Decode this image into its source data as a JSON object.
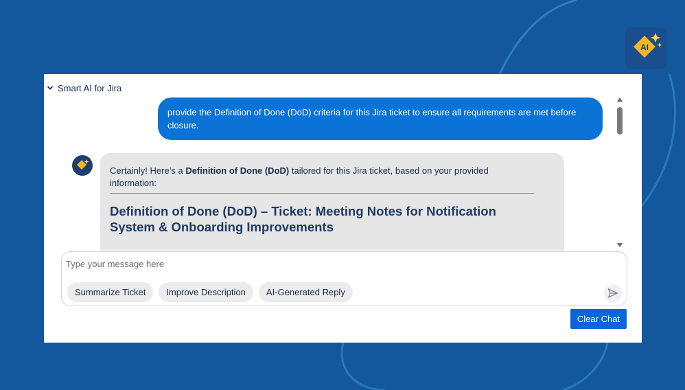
{
  "colors": {
    "background": "#13579c",
    "user_bubble": "#0b73d5",
    "bot_bubble": "#e6e6e6",
    "accent_gold": "#f5b623",
    "clear_button": "#0b66d8"
  },
  "app_badge": {
    "icon": "ai-sparkle-logo",
    "label": "AI"
  },
  "panel": {
    "title": "Smart AI for Jira",
    "collapse_icon": "chevron-down-icon"
  },
  "messages": {
    "user": "provide the Definition of Done (DoD) criteria for this Jira ticket to ensure all requirements are met before closure.",
    "bot": {
      "avatar_label": "AI",
      "intro_prefix": "Certainly! Here’s a ",
      "intro_bold": "Definition of Done (DoD)",
      "intro_suffix": " tailored for this Jira ticket, based on your provided information:",
      "heading": "Definition of Done (DoD) – Ticket: Meeting Notes for Notification System & Onboarding Improvements"
    }
  },
  "composer": {
    "placeholder": "Type your message here",
    "value": "",
    "chips": [
      "Summarize Ticket",
      "Improve Description",
      "AI-Generated Reply"
    ],
    "send_icon": "send-icon"
  },
  "clear_button": {
    "label": "Clear Chat"
  }
}
